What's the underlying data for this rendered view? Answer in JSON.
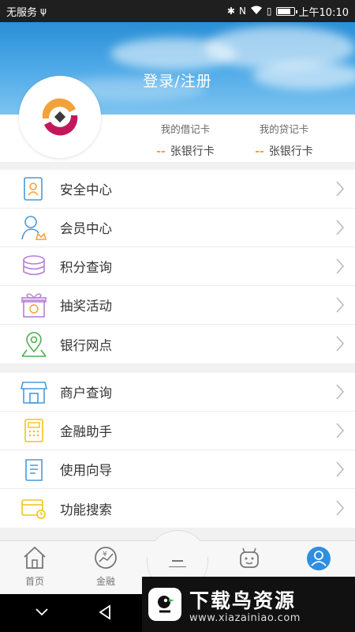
{
  "status_bar": {
    "carrier": "无服务",
    "usb_icon": "usb-icon",
    "time": "上午10:10",
    "icons": [
      "bluetooth-icon",
      "nfc-icon",
      "wifi-icon",
      "battery-icon"
    ]
  },
  "header": {
    "login_label": "登录/注册"
  },
  "cards": {
    "debit": {
      "label": "我的借记卡",
      "value": "张银行卡"
    },
    "credit": {
      "label": "我的贷记卡",
      "value": "张银行卡"
    }
  },
  "menu_group_1": [
    {
      "label": "安全中心",
      "icon": "security-icon"
    },
    {
      "label": "会员中心",
      "icon": "member-icon"
    },
    {
      "label": "积分查询",
      "icon": "points-icon"
    },
    {
      "label": "抽奖活动",
      "icon": "lottery-gift-icon"
    },
    {
      "label": "银行网点",
      "icon": "location-pin-icon"
    }
  ],
  "menu_group_2": [
    {
      "label": "商户查询",
      "icon": "shop-icon"
    },
    {
      "label": "金融助手",
      "icon": "calculator-icon"
    },
    {
      "label": "使用向导",
      "icon": "guide-book-icon"
    },
    {
      "label": "功能搜索",
      "icon": "card-search-icon"
    }
  ],
  "bottom_nav": {
    "home": "首页",
    "finance": "金融"
  },
  "watermark": {
    "title": "下载鸟资源",
    "url": "www.xiazainiao.com"
  },
  "colors": {
    "header_blue": "#2a8fd6",
    "accent_orange": "#f2a23a",
    "icon_blue": "#4a9ad8",
    "icon_purple": "#b77ed9",
    "icon_green": "#4caf50",
    "icon_yellow": "#f0c419",
    "active_nav": "#2f8ee0"
  }
}
